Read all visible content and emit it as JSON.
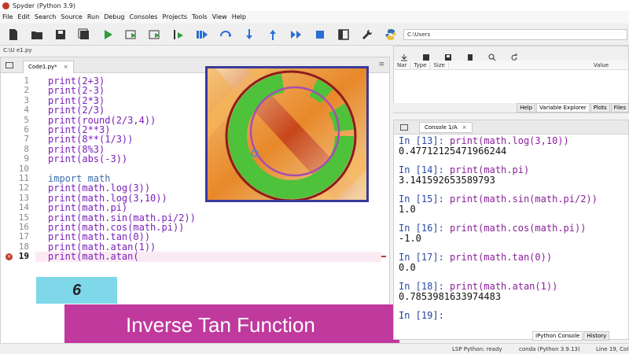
{
  "window": {
    "title": "Spyder (Python 3.9)"
  },
  "menu": [
    "File",
    "Edit",
    "Search",
    "Source",
    "Run",
    "Debug",
    "Consoles",
    "Projects",
    "Tools",
    "View",
    "Help"
  ],
  "toolbar": {
    "icons": [
      "new-file-icon",
      "open-folder-icon",
      "save-icon",
      "save-all-icon",
      "run-icon",
      "run-cell-icon",
      "run-cell-advance-icon",
      "run-selection-icon",
      "debug-icon",
      "step-over-icon",
      "step-into-icon",
      "step-out-icon",
      "continue-icon",
      "stop-icon",
      "maximize-pane-icon",
      "preferences-icon",
      "python-path-icon"
    ],
    "working_dir": "C:\\Users"
  },
  "editor": {
    "path": "C:\\U                                        e1.py",
    "tab_label": "Code1.py*",
    "tab_close": "×",
    "lines": [
      {
        "n": "1",
        "code": "print(2+3)"
      },
      {
        "n": "2",
        "code": "print(2-3)"
      },
      {
        "n": "3",
        "code": "print(2*3)"
      },
      {
        "n": "4",
        "code": "print(2/3)"
      },
      {
        "n": "5",
        "code": "print(round(2/3,4))"
      },
      {
        "n": "6",
        "code": "print(2**3)"
      },
      {
        "n": "7",
        "code": "print(8**(1/3))"
      },
      {
        "n": "8",
        "code": "print(8%3)"
      },
      {
        "n": "9",
        "code": "print(abs(-3))"
      },
      {
        "n": "10",
        "code": ""
      },
      {
        "n": "11",
        "code": "import math"
      },
      {
        "n": "12",
        "code": "print(math.log(3))"
      },
      {
        "n": "13",
        "code": "print(math.log(3,10))"
      },
      {
        "n": "14",
        "code": "print(math.pi)"
      },
      {
        "n": "15",
        "code": "print(math.sin(math.pi/2))"
      },
      {
        "n": "16",
        "code": "print(math.cos(math.pi))"
      },
      {
        "n": "17",
        "code": "print(math.tan(0))"
      },
      {
        "n": "18",
        "code": "print(math.atan(1))"
      },
      {
        "n": "19",
        "code": "print(math.atan("
      }
    ],
    "current_line": "19"
  },
  "overlay": {
    "number": "6",
    "banner": "Inverse Tan Function"
  },
  "variable_explorer": {
    "columns": [
      "Nar",
      "Type",
      "Size",
      "Value"
    ],
    "tabs": [
      "Help",
      "Variable Explorer",
      "Plots",
      "Files"
    ],
    "active_tab": "Variable Explorer"
  },
  "console": {
    "tab_label": "Console 1/A",
    "tab_close": "×",
    "entries": [
      {
        "prompt": "In [13]: ",
        "code": "print(math.log(3,10))",
        "output": "0.47712125471966244"
      },
      {
        "prompt": "In [14]: ",
        "code": "print(math.pi)",
        "output": "3.141592653589793"
      },
      {
        "prompt": "In [15]: ",
        "code": "print(math.sin(math.pi/2))",
        "output": "1.0"
      },
      {
        "prompt": "In [16]: ",
        "code": "print(math.cos(math.pi))",
        "output": "-1.0"
      },
      {
        "prompt": "In [17]: ",
        "code": "print(math.tan(0))",
        "output": "0.0"
      },
      {
        "prompt": "In [18]: ",
        "code": "print(math.atan(1))",
        "output": "0.7853981633974483"
      }
    ],
    "final_prompt": "In [19]:",
    "bottom_tabs": [
      "IPython Console",
      "History"
    ],
    "active_bottom_tab": "IPython Console"
  },
  "status": {
    "lsp": "LSP Python: ready",
    "conda": "conda (Python 3.9.13)",
    "position": "Line 19, Col"
  },
  "colors": {
    "banner": "#c0399d",
    "badge": "#7fd8ea",
    "code_purple": "#7a1fb8",
    "prompt_blue": "#1f3f9a"
  }
}
